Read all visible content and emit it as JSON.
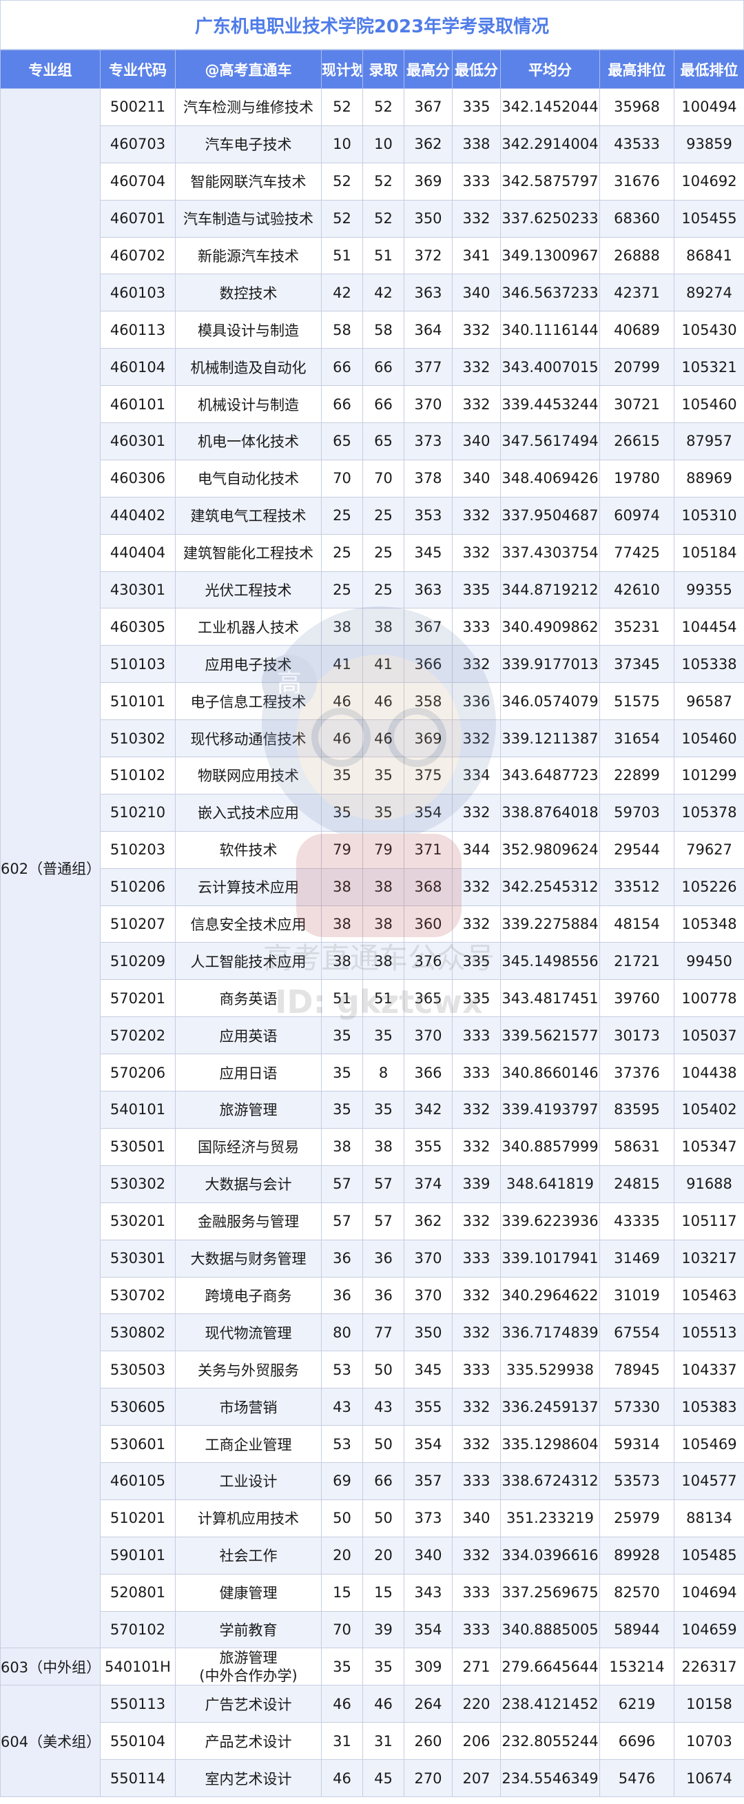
{
  "title": "广东机电职业技术学院2023年学考录取情况",
  "headers": [
    "专业组",
    "专业代码",
    "@高考直通车",
    "现计划",
    "录取",
    "最高分",
    "最低分",
    "平均分",
    "最高排位",
    "最低排位"
  ],
  "groups": [
    {
      "name": "602（普通组）",
      "rows": [
        [
          "500211",
          "汽车检测与维修技术",
          "52",
          "52",
          "367",
          "335",
          "342.1452044",
          "35968",
          "100494"
        ],
        [
          "460703",
          "汽车电子技术",
          "10",
          "10",
          "362",
          "338",
          "342.2914004",
          "43533",
          "93859"
        ],
        [
          "460704",
          "智能网联汽车技术",
          "52",
          "52",
          "369",
          "333",
          "342.5875797",
          "31676",
          "104692"
        ],
        [
          "460701",
          "汽车制造与试验技术",
          "52",
          "52",
          "350",
          "332",
          "337.6250233",
          "68360",
          "105455"
        ],
        [
          "460702",
          "新能源汽车技术",
          "51",
          "51",
          "372",
          "341",
          "349.1300967",
          "26888",
          "86841"
        ],
        [
          "460103",
          "数控技术",
          "42",
          "42",
          "363",
          "340",
          "346.5637233",
          "42371",
          "89274"
        ],
        [
          "460113",
          "模具设计与制造",
          "58",
          "58",
          "364",
          "332",
          "340.1116144",
          "40689",
          "105430"
        ],
        [
          "460104",
          "机械制造及自动化",
          "66",
          "66",
          "377",
          "332",
          "343.4007015",
          "20799",
          "105321"
        ],
        [
          "460101",
          "机械设计与制造",
          "66",
          "66",
          "370",
          "332",
          "339.4453244",
          "30721",
          "105460"
        ],
        [
          "460301",
          "机电一体化技术",
          "65",
          "65",
          "373",
          "340",
          "347.5617494",
          "26615",
          "87957"
        ],
        [
          "460306",
          "电气自动化技术",
          "70",
          "70",
          "378",
          "340",
          "348.4069426",
          "19780",
          "88969"
        ],
        [
          "440402",
          "建筑电气工程技术",
          "25",
          "25",
          "353",
          "332",
          "337.9504687",
          "60974",
          "105310"
        ],
        [
          "440404",
          "建筑智能化工程技术",
          "25",
          "25",
          "345",
          "332",
          "337.4303754",
          "77425",
          "105184"
        ],
        [
          "430301",
          "光伏工程技术",
          "25",
          "25",
          "363",
          "335",
          "344.8719212",
          "42610",
          "99355"
        ],
        [
          "460305",
          "工业机器人技术",
          "38",
          "38",
          "367",
          "333",
          "340.4909862",
          "35231",
          "104454"
        ],
        [
          "510103",
          "应用电子技术",
          "41",
          "41",
          "366",
          "332",
          "339.9177013",
          "37345",
          "105338"
        ],
        [
          "510101",
          "电子信息工程技术",
          "46",
          "46",
          "358",
          "336",
          "346.0574079",
          "51575",
          "96587"
        ],
        [
          "510302",
          "现代移动通信技术",
          "46",
          "46",
          "369",
          "332",
          "339.1211387",
          "31654",
          "105460"
        ],
        [
          "510102",
          "物联网应用技术",
          "35",
          "35",
          "375",
          "334",
          "343.6487723",
          "22899",
          "101299"
        ],
        [
          "510210",
          "嵌入式技术应用",
          "35",
          "35",
          "354",
          "332",
          "338.8764018",
          "59703",
          "105378"
        ],
        [
          "510203",
          "软件技术",
          "79",
          "79",
          "371",
          "344",
          "352.9809624",
          "29544",
          "79627"
        ],
        [
          "510206",
          "云计算技术应用",
          "38",
          "38",
          "368",
          "332",
          "342.2545312",
          "33512",
          "105226"
        ],
        [
          "510207",
          "信息安全技术应用",
          "38",
          "38",
          "360",
          "332",
          "339.2275884",
          "48154",
          "105348"
        ],
        [
          "510209",
          "人工智能技术应用",
          "38",
          "38",
          "376",
          "335",
          "345.1498556",
          "21721",
          "99450"
        ],
        [
          "570201",
          "商务英语",
          "51",
          "51",
          "365",
          "335",
          "343.4817451",
          "39760",
          "100778"
        ],
        [
          "570202",
          "应用英语",
          "35",
          "35",
          "370",
          "333",
          "339.5621577",
          "30173",
          "105037"
        ],
        [
          "570206",
          "应用日语",
          "35",
          "8",
          "366",
          "333",
          "340.8660146",
          "37376",
          "104438"
        ],
        [
          "540101",
          "旅游管理",
          "35",
          "35",
          "342",
          "332",
          "339.4193797",
          "83595",
          "105402"
        ],
        [
          "530501",
          "国际经济与贸易",
          "38",
          "38",
          "355",
          "332",
          "340.8857999",
          "58631",
          "105347"
        ],
        [
          "530302",
          "大数据与会计",
          "57",
          "57",
          "374",
          "339",
          "348.641819",
          "24815",
          "91688"
        ],
        [
          "530201",
          "金融服务与管理",
          "57",
          "57",
          "362",
          "332",
          "339.6223936",
          "43335",
          "105117"
        ],
        [
          "530301",
          "大数据与财务管理",
          "36",
          "36",
          "370",
          "333",
          "339.1017941",
          "31469",
          "103217"
        ],
        [
          "530702",
          "跨境电子商务",
          "36",
          "36",
          "370",
          "332",
          "340.2964622",
          "31019",
          "105463"
        ],
        [
          "530802",
          "现代物流管理",
          "80",
          "77",
          "350",
          "332",
          "336.7174839",
          "67554",
          "105513"
        ],
        [
          "530503",
          "关务与外贸服务",
          "53",
          "50",
          "345",
          "333",
          "335.529938",
          "78945",
          "104337"
        ],
        [
          "530605",
          "市场营销",
          "43",
          "43",
          "355",
          "332",
          "336.2459137",
          "57330",
          "105383"
        ],
        [
          "530601",
          "工商企业管理",
          "53",
          "50",
          "354",
          "332",
          "335.1298604",
          "59314",
          "105469"
        ],
        [
          "460105",
          "工业设计",
          "69",
          "66",
          "357",
          "333",
          "338.6724312",
          "53573",
          "104577"
        ],
        [
          "510201",
          "计算机应用技术",
          "50",
          "50",
          "373",
          "340",
          "351.233219",
          "25979",
          "88134"
        ],
        [
          "590101",
          "社会工作",
          "20",
          "20",
          "340",
          "332",
          "334.0396616",
          "89928",
          "105485"
        ],
        [
          "520801",
          "健康管理",
          "15",
          "15",
          "343",
          "333",
          "337.2569675",
          "82570",
          "104694"
        ],
        [
          "570102",
          "学前教育",
          "70",
          "39",
          "354",
          "333",
          "340.8885005",
          "58944",
          "104659"
        ]
      ]
    },
    {
      "name": "603（中外组）",
      "rows": [
        [
          "540101H",
          "旅游管理\n(中外合作办学)",
          "35",
          "35",
          "309",
          "271",
          "279.6645644",
          "153214",
          "226317"
        ]
      ]
    },
    {
      "name": "604（美术组）",
      "rows": [
        [
          "550113",
          "广告艺术设计",
          "46",
          "46",
          "264",
          "220",
          "238.4121452",
          "6219",
          "10158"
        ],
        [
          "550104",
          "产品艺术设计",
          "31",
          "31",
          "260",
          "206",
          "232.8055244",
          "6696",
          "10703"
        ],
        [
          "550114",
          "室内艺术设计",
          "46",
          "45",
          "270",
          "207",
          "234.5546349",
          "5476",
          "10674"
        ]
      ]
    }
  ],
  "watermark": {
    "badge_text": "高",
    "line1": "高考直通车公众号",
    "line2": "ID: gkztcwx"
  }
}
